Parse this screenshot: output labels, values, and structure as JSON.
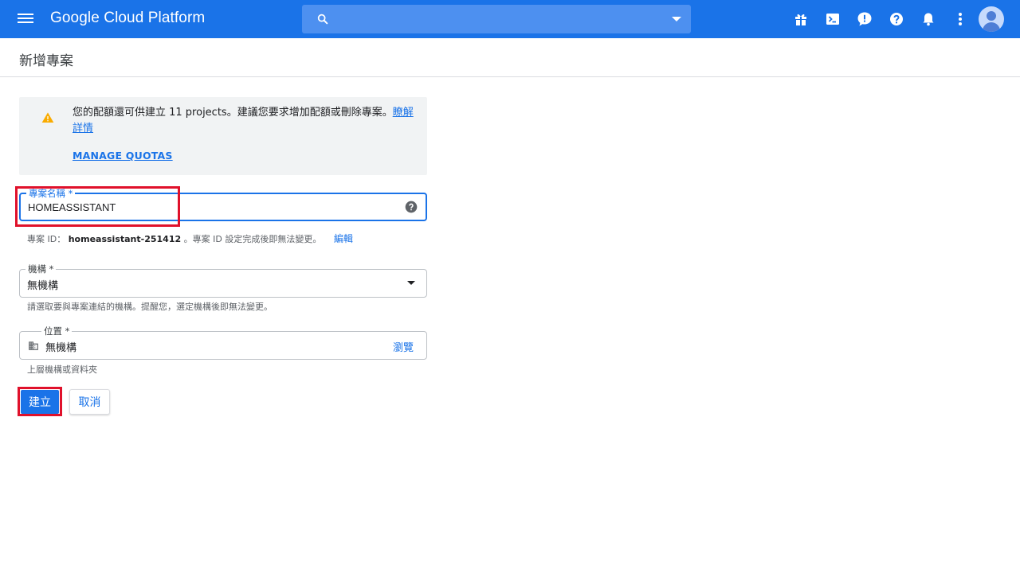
{
  "app": {
    "brand": "Google Cloud Platform",
    "search_placeholder": ""
  },
  "topbar_icons": [
    "gift-icon",
    "cloud-shell-icon",
    "feedback-icon",
    "help-icon",
    "notifications-icon",
    "more-vert-icon"
  ],
  "page": {
    "title": "新增專案"
  },
  "warning": {
    "message": "您的配額還可供建立 11 projects。建議您要求增加配額或刪除專案。",
    "learn_more": "瞭解詳情",
    "manage_quotas": "MANAGE QUOTAS"
  },
  "project_name": {
    "label": "專案名稱 *",
    "value": "HOMEASSISTANT"
  },
  "project_id": {
    "prefix": "專案 ID：",
    "value": "homeassistant-251412",
    "note": "。專案 ID 設定完成後即無法變更。",
    "edit": "編輯"
  },
  "organization": {
    "label": "機構 *",
    "value": "無機構",
    "helper": "請選取要與專案連結的機構。提醒您，選定機構後即無法變更。"
  },
  "location": {
    "label": "位置 *",
    "value": "無機構",
    "browse": "瀏覽",
    "helper": "上層機構或資料夾"
  },
  "actions": {
    "create": "建立",
    "cancel": "取消"
  },
  "colors": {
    "primary": "#1a73e8",
    "topbar": "#1a73e8",
    "highlight": "#e0112b",
    "warning_icon": "#f9ab00"
  }
}
